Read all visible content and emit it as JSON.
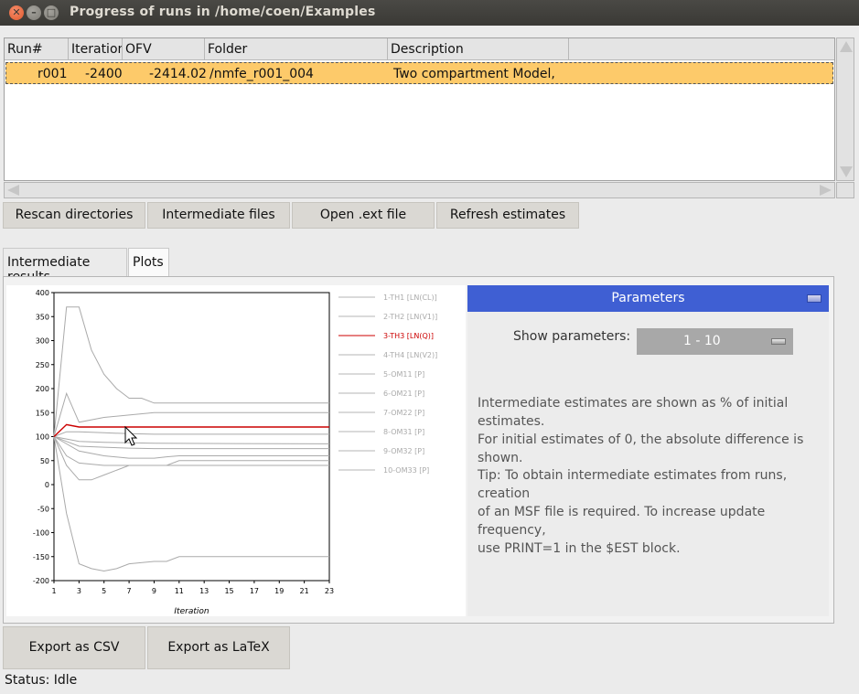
{
  "window": {
    "title": "Progress of runs in /home/coen/Examples",
    "close_icon": "close-icon",
    "minimize_icon": "minimize-icon",
    "maximize_icon": "maximize-icon"
  },
  "runs_table": {
    "columns": [
      "Run#",
      "Iteration",
      "OFV",
      "Folder",
      "Description"
    ],
    "rows": [
      {
        "run": "r001",
        "iteration": "-2400",
        "ofv": "-2414.02",
        "folder": "/nmfe_r001_004",
        "description": "Two compartment Model,"
      }
    ],
    "selected_row_color": "#fdca6a"
  },
  "toolbar": {
    "rescan": "Rescan directories",
    "intermediate": "Intermediate files",
    "open_ext": "Open .ext file",
    "refresh": "Refresh estimates"
  },
  "tabs": [
    {
      "label": "Intermediate results",
      "active": false
    },
    {
      "label": "Plots",
      "active": true
    }
  ],
  "chart_data": {
    "type": "line",
    "title": "",
    "xlabel": "Iteration",
    "ylabel": "",
    "xlim": [
      1,
      23
    ],
    "ylim": [
      -200,
      400
    ],
    "x_ticks": [
      1,
      3,
      5,
      7,
      9,
      11,
      13,
      15,
      17,
      19,
      21,
      23
    ],
    "y_ticks": [
      400,
      350,
      300,
      250,
      200,
      150,
      100,
      50,
      0,
      -50,
      -100,
      -150,
      -200
    ],
    "legend_position": "right",
    "highlight_color": "#cc0000",
    "series": [
      {
        "name": "1-TH1 [LN(CL)]",
        "highlighted": false,
        "x": [
          1,
          2,
          3,
          5,
          7,
          9,
          23
        ],
        "y": [
          100,
          90,
          80,
          78,
          76,
          75,
          75
        ]
      },
      {
        "name": "2-TH2 [LN(V1)]",
        "highlighted": false,
        "x": [
          1,
          2,
          3,
          4,
          5,
          6,
          7,
          8,
          9,
          23
        ],
        "y": [
          100,
          370,
          370,
          280,
          230,
          200,
          180,
          180,
          170,
          170
        ]
      },
      {
        "name": "3-TH3 [LN(Q)]",
        "highlighted": true,
        "x": [
          1,
          2,
          3,
          4,
          5,
          23
        ],
        "y": [
          100,
          125,
          120,
          120,
          120,
          120
        ]
      },
      {
        "name": "4-TH4 [LN(V2)]",
        "highlighted": false,
        "x": [
          1,
          2,
          3,
          5,
          7,
          9,
          23
        ],
        "y": [
          100,
          190,
          130,
          140,
          145,
          150,
          150
        ]
      },
      {
        "name": "5-OM11 [P]",
        "highlighted": false,
        "x": [
          1,
          2,
          3,
          4,
          5,
          7,
          9,
          10,
          11,
          23
        ],
        "y": [
          100,
          40,
          10,
          10,
          20,
          40,
          40,
          40,
          50,
          50
        ]
      },
      {
        "name": "6-OM21 [P]",
        "highlighted": false,
        "x": [
          1,
          2,
          3,
          5,
          7,
          9,
          10,
          11,
          23
        ],
        "y": [
          100,
          60,
          45,
          40,
          40,
          40,
          40,
          40,
          40
        ]
      },
      {
        "name": "7-OM22 [P]",
        "highlighted": false,
        "x": [
          1,
          3,
          5,
          7,
          9,
          23
        ],
        "y": [
          100,
          90,
          88,
          87,
          86,
          85
        ]
      },
      {
        "name": "8-OM31 [P]",
        "highlighted": false,
        "x": [
          1,
          2,
          3,
          5,
          7,
          9,
          23
        ],
        "y": [
          100,
          110,
          110,
          108,
          106,
          105,
          105
        ]
      },
      {
        "name": "9-OM32 [P]",
        "highlighted": false,
        "x": [
          1,
          2,
          3,
          4,
          5,
          6,
          7,
          9,
          10,
          11,
          23
        ],
        "y": [
          100,
          -60,
          -165,
          -175,
          -180,
          -175,
          -165,
          -160,
          -160,
          -150,
          -150
        ]
      },
      {
        "name": "10-OM33 [P]",
        "highlighted": false,
        "x": [
          1,
          3,
          5,
          7,
          9,
          10,
          11,
          23
        ],
        "y": [
          100,
          70,
          60,
          55,
          55,
          58,
          60,
          60
        ]
      }
    ]
  },
  "params_panel": {
    "header": "Parameters",
    "show_label": "Show parameters:",
    "show_value": "1 - 10",
    "info1_line1": "Intermediate estimates are shown as % of initial estimates.",
    "info1_line2": "For initial estimates of 0, the absolute difference is shown.",
    "tip_line1": "Tip: To obtain intermediate estimates from runs, creation",
    "tip_line2": "of an MSF file is required. To increase update frequency,",
    "tip_line3": "use PRINT=1 in the $EST block.",
    "header_color": "#3f5fd3"
  },
  "export": {
    "csv": "Export as CSV",
    "latex": "Export as LaTeX"
  },
  "status": "Status: Idle"
}
